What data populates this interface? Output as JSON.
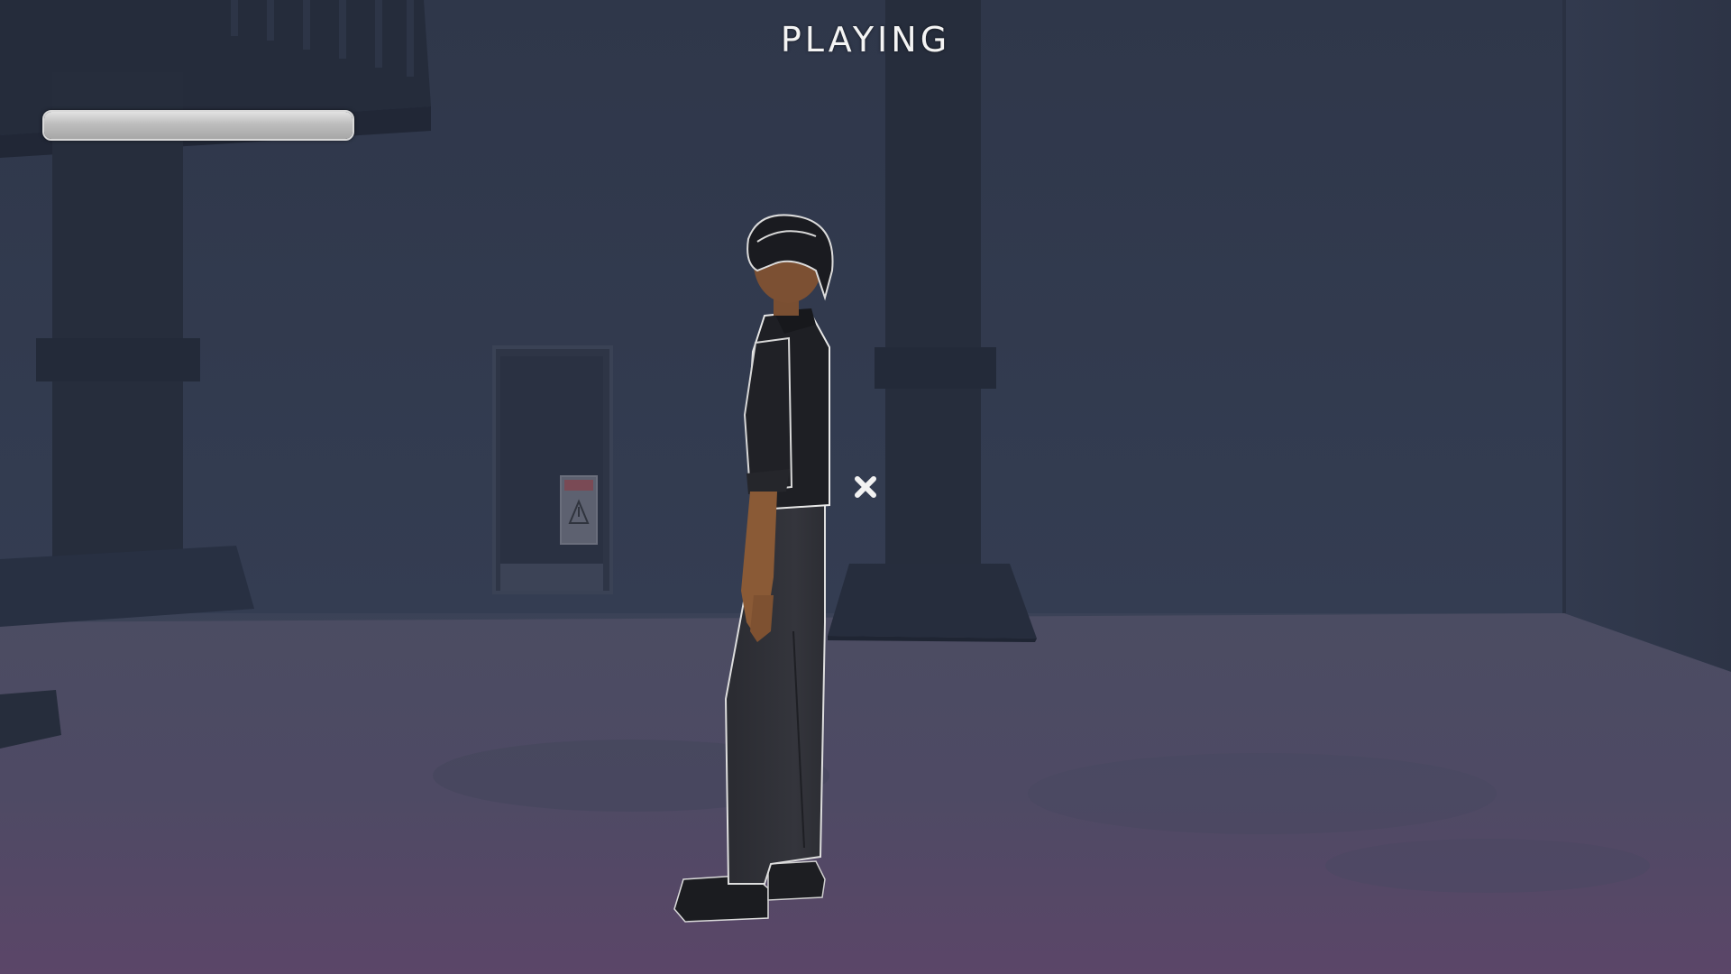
{
  "hud": {
    "status": "PLAYING",
    "health_fraction": 1.0,
    "crosshair_icon": "x-crosshair-icon"
  },
  "colors": {
    "hud_text": "#f4f4f4",
    "health_fill": "#c2c2c2",
    "wall": "#323b50",
    "floor": "#4b4862"
  }
}
